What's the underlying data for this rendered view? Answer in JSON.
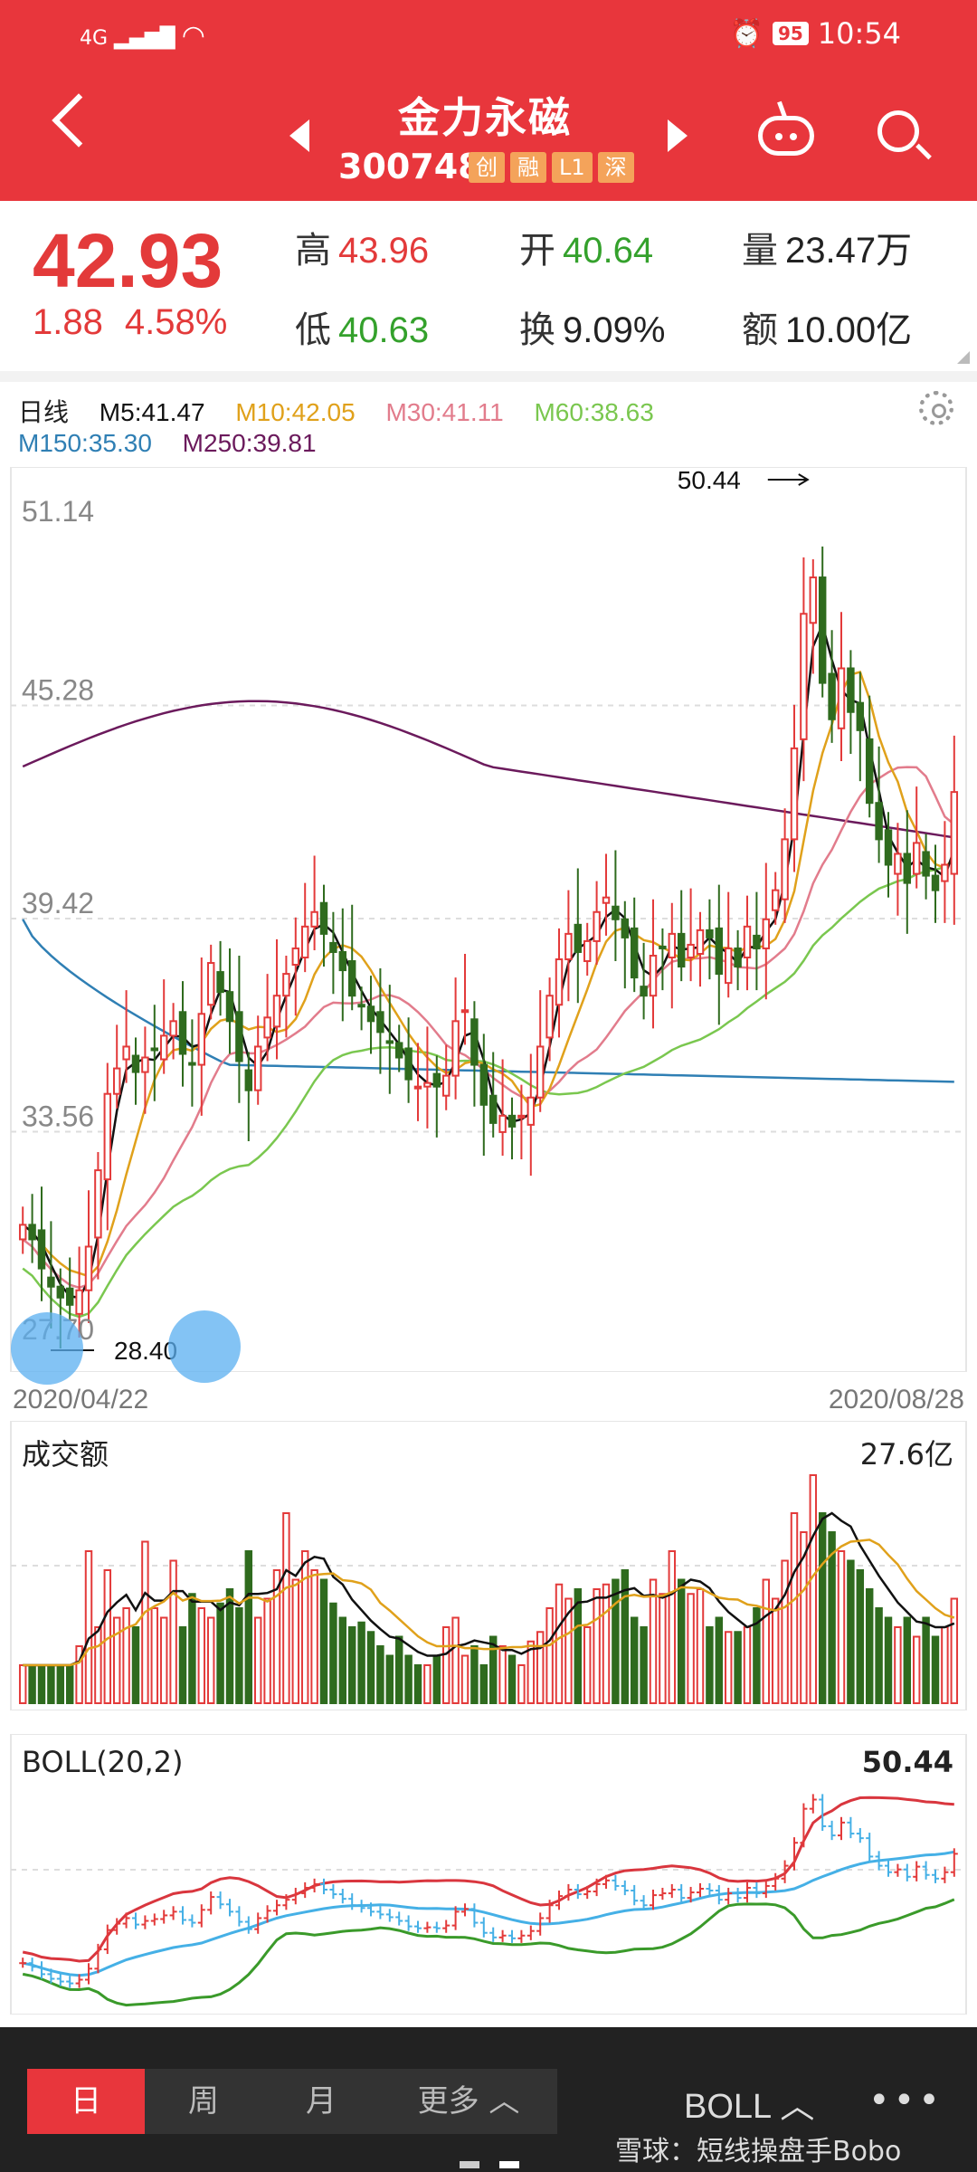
{
  "status_bar": {
    "network": "4G",
    "battery": "95",
    "time": "10:54"
  },
  "header": {
    "stock_name": "金力永磁",
    "stock_code": "300748",
    "tags": [
      "创",
      "融",
      "L1",
      "深"
    ]
  },
  "quote": {
    "price": "42.93",
    "change": "1.88",
    "change_pct": "4.58%",
    "high_label": "高",
    "high": "43.96",
    "open_label": "开",
    "open": "40.64",
    "volume_label": "量",
    "volume": "23.47万",
    "low_label": "低",
    "low": "40.63",
    "turnover_label": "换",
    "turnover": "9.09%",
    "amount_label": "额",
    "amount": "10.00亿"
  },
  "ma_legend": {
    "period": "日线",
    "m5": "M5:41.47",
    "m10": "M10:42.05",
    "m30": "M30:41.11",
    "m60": "M60:38.63",
    "m150": "M150:35.30",
    "m250": "M250:39.81"
  },
  "colors": {
    "up": "#e33a3a",
    "down": "#2f6b1e",
    "m5": "#111111",
    "m10": "#e0a11b",
    "m30": "#e27c8c",
    "m60": "#7ac74f",
    "m150": "#2f7fb4",
    "m250": "#6b1a5c",
    "boll_upper": "#d9363e",
    "boll_mid": "#45b0e6",
    "boll_lower": "#3a9a2a"
  },
  "chart_data": [
    {
      "type": "candlestick",
      "y_ticks": [
        "51.14",
        "45.28",
        "39.42",
        "33.56",
        "27.70"
      ],
      "ylim": [
        27.7,
        51.14
      ],
      "annotations": {
        "max": "50.44",
        "min": "28.40"
      },
      "x_start": "2020/04/22",
      "x_end": "2020/08/28",
      "close": [
        31.0,
        30.6,
        29.8,
        29.3,
        29.0,
        28.8,
        29.2,
        30.4,
        32.5,
        34.6,
        35.3,
        35.9,
        35.2,
        35.6,
        35.8,
        36.2,
        36.6,
        35.7,
        35.4,
        36.8,
        38.2,
        37.4,
        36.6,
        35.5,
        34.7,
        35.9,
        36.7,
        37.3,
        37.9,
        38.6,
        39.2,
        39.6,
        39.0,
        38.5,
        38.0,
        37.3,
        37.0,
        36.6,
        36.3,
        36.0,
        35.6,
        35.0,
        34.8,
        34.9,
        34.8,
        35.1,
        36.6,
        36.9,
        35.4,
        34.3,
        33.8,
        34.0,
        33.7,
        34.0,
        34.5,
        35.9,
        37.3,
        38.3,
        39.0,
        38.5,
        38.8,
        39.6,
        40.0,
        39.4,
        38.9,
        37.8,
        37.3,
        38.4,
        38.6,
        39.0,
        38.1,
        38.7,
        39.1,
        38.9,
        37.9,
        38.6,
        38.1,
        39.2,
        38.6,
        39.4,
        40.2,
        41.6,
        44.1,
        47.8,
        48.8,
        45.9,
        44.9,
        46.3,
        45.1,
        44.6,
        42.6,
        41.6,
        40.9,
        41.2,
        40.4,
        41.5,
        40.6,
        40.2,
        40.9,
        42.9
      ],
      "amount_value": "27.6亿",
      "amount": [
        0.8,
        0.8,
        0.8,
        0.8,
        0.8,
        0.8,
        1.2,
        3.2,
        1.6,
        2.8,
        1.8,
        2.0,
        1.6,
        3.4,
        2.0,
        1.8,
        3.0,
        1.6,
        2.3,
        2.0,
        1.8,
        2.1,
        2.4,
        2.0,
        3.2,
        1.8,
        2.2,
        2.8,
        4.0,
        2.6,
        3.2,
        2.8,
        2.6,
        2.1,
        1.8,
        1.6,
        1.7,
        1.5,
        1.2,
        1.0,
        1.4,
        1.0,
        0.8,
        0.8,
        1.0,
        1.6,
        1.8,
        1.0,
        1.2,
        0.8,
        1.4,
        1.2,
        1.0,
        0.8,
        1.3,
        1.5,
        2.0,
        2.5,
        2.2,
        2.4,
        1.6,
        2.4,
        2.5,
        2.6,
        2.8,
        1.8,
        1.6,
        2.6,
        2.3,
        3.2,
        2.6,
        2.3,
        2.4,
        1.6,
        1.8,
        1.5,
        1.5,
        1.6,
        2.0,
        2.6,
        2.2,
        3.0,
        4.0,
        3.6,
        4.8,
        4.0,
        3.6,
        3.2,
        3.0,
        2.8,
        2.4,
        2.0,
        1.8,
        1.6,
        1.8,
        1.4,
        1.8,
        1.4,
        1.6,
        2.2
      ]
    }
  ],
  "volume_panel": {
    "title": "成交额"
  },
  "boll_panel": {
    "title": "BOLL(20,2)",
    "value": "50.44"
  },
  "bottom_bar": {
    "tabs": [
      "日",
      "周",
      "月",
      "更多 ︿"
    ],
    "indicator": "BOLL ︿",
    "more": "•••",
    "watermark": "雪球：短线操盘手Bobo"
  }
}
